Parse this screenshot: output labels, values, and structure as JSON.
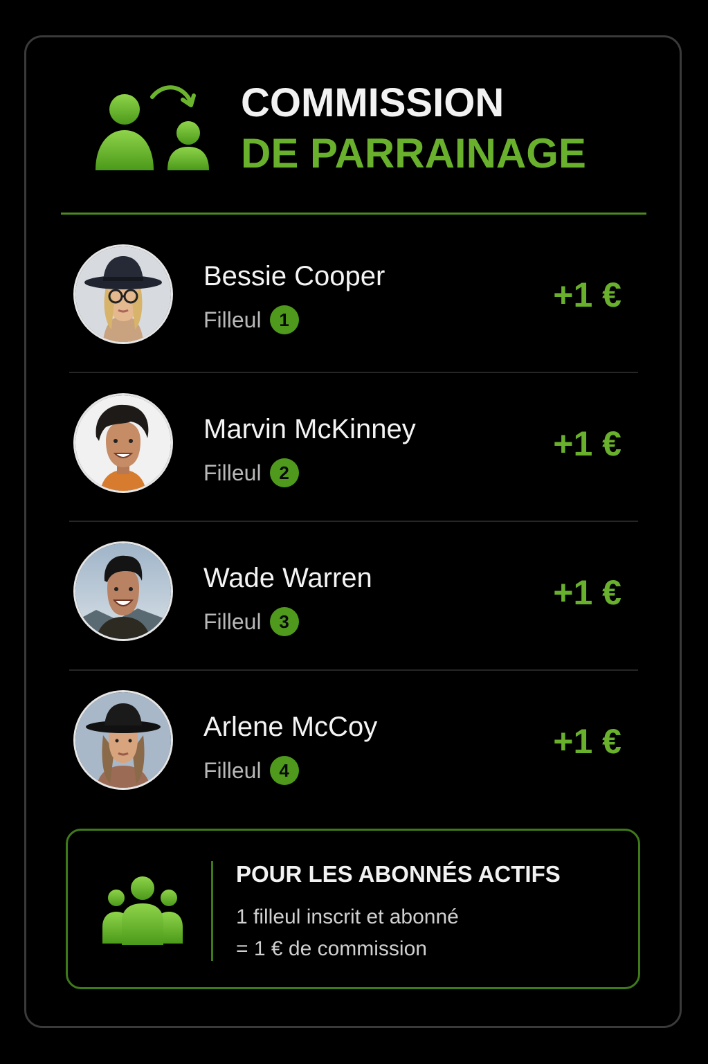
{
  "header": {
    "title_line1": "COMMISSION",
    "title_line2": "DE PARRAINAGE",
    "icon": "referral-transfer-icon"
  },
  "referrals": [
    {
      "name": "Bessie Cooper",
      "label": "Filleul",
      "number": "1",
      "amount": "+1 €"
    },
    {
      "name": "Marvin McKinney",
      "label": "Filleul",
      "number": "2",
      "amount": "+1 €"
    },
    {
      "name": "Wade Warren",
      "label": "Filleul",
      "number": "3",
      "amount": "+1 €"
    },
    {
      "name": "Arlene McCoy",
      "label": "Filleul",
      "number": "4",
      "amount": "+1 €"
    }
  ],
  "info": {
    "icon": "group-icon",
    "title": "POUR LES ABONNÉS ACTIFS",
    "line1": "1 filleul inscrit et abonné",
    "line2": "= 1 € de commission"
  },
  "colors": {
    "accent": "#69b02d",
    "background": "#000000",
    "border": "#3a3a3a"
  }
}
